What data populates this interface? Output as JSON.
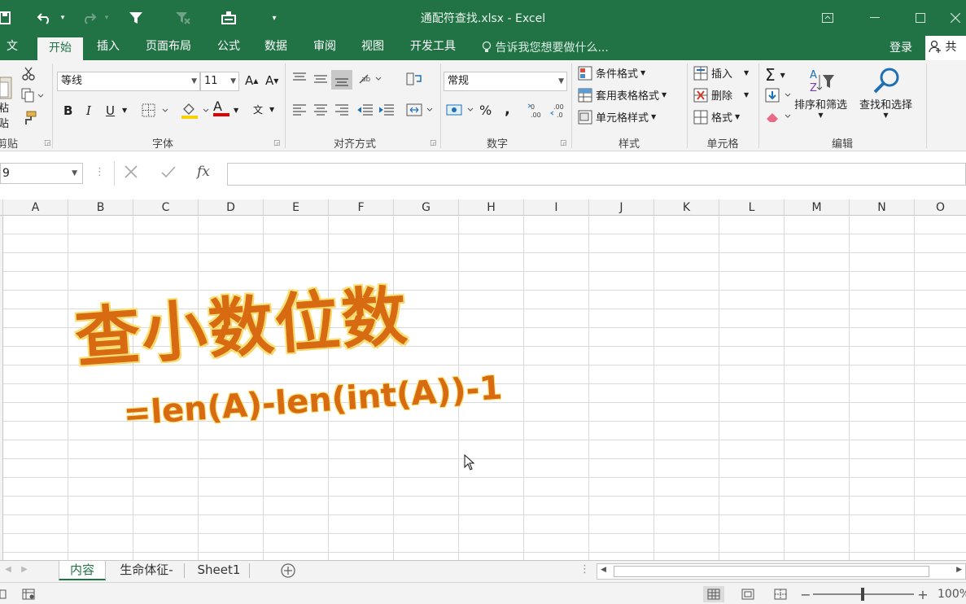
{
  "window": {
    "title": "通配符查找.xlsx - Excel",
    "quick_access": [
      "save-icon",
      "undo-icon",
      "redo-icon",
      "filter-icon",
      "clear-filter-icon",
      "form-icon",
      "customize-icon"
    ]
  },
  "tabs": [
    {
      "label": "文件"
    },
    {
      "label": "开始",
      "active": true
    },
    {
      "label": "插入"
    },
    {
      "label": "页面布局"
    },
    {
      "label": "公式"
    },
    {
      "label": "数据"
    },
    {
      "label": "审阅"
    },
    {
      "label": "视图"
    },
    {
      "label": "开发工具"
    }
  ],
  "tell_me": "告诉我您想要做什么...",
  "login": "登录",
  "share": "共享",
  "ribbon": {
    "clipboard": {
      "label": "剪贴板",
      "paste": "粘贴"
    },
    "font": {
      "label": "字体",
      "name": "等线",
      "size": "11",
      "bold": "B",
      "italic": "I",
      "underline": "U",
      "grow": "A",
      "shrink": "A",
      "color_letter": "A",
      "phonetic": "文"
    },
    "alignment": {
      "label": "对齐方式"
    },
    "number": {
      "label": "数字",
      "format": "常规",
      "percent": "%",
      "comma": ","
    },
    "styles": {
      "label": "样式",
      "conditional": "条件格式",
      "table": "套用表格格式",
      "cell": "单元格样式"
    },
    "cells": {
      "label": "单元格",
      "insert": "插入",
      "delete": "删除",
      "format": "格式"
    },
    "editing": {
      "label": "编辑",
      "sort": "排序和筛选",
      "find": "查找和选择"
    }
  },
  "formula_bar": {
    "name_box": "9",
    "formula": "",
    "fx": "fx"
  },
  "columns": [
    "A",
    "B",
    "C",
    "D",
    "E",
    "F",
    "G",
    "H",
    "I",
    "J",
    "K",
    "L",
    "M",
    "N",
    "O"
  ],
  "content": {
    "headline": "查小数位数",
    "formula": "=len(A)-len(int(A))-1"
  },
  "sheets": [
    {
      "label": "内容",
      "active": true
    },
    {
      "label": "生命体征-"
    },
    {
      "label": "Sheet1"
    }
  ],
  "status": {
    "zoom": "100%"
  },
  "colors": {
    "accent": "#217346",
    "art_fill": "#d86a12",
    "art_glow": "#f7e27a"
  }
}
